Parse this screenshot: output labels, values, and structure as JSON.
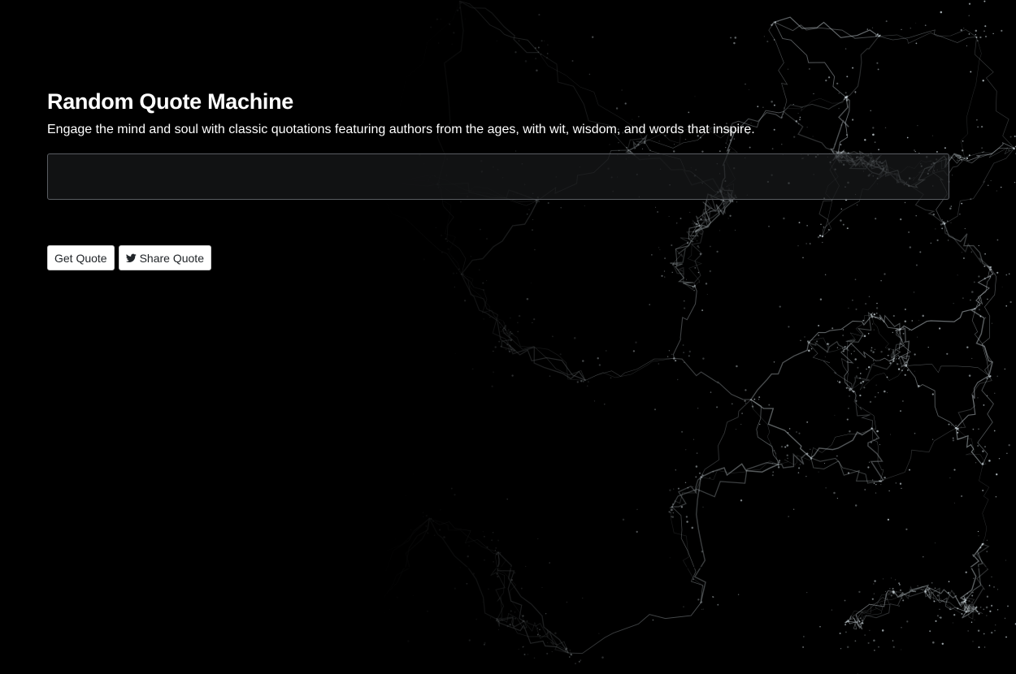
{
  "header": {
    "title": "Random Quote Machine",
    "subtitle": "Engage the mind and soul with classic quotations featuring authors from the ages, with wit, wisdom, and words that inspire."
  },
  "quote": {
    "text": ""
  },
  "actions": {
    "get_quote_label": "Get Quote",
    "share_quote_label": "Share Quote",
    "share_icon": "twitter-bird-icon"
  },
  "background": {
    "image": "cosmic-web-filaments",
    "base_color": "#000000",
    "filament_color": "#c9d3d8"
  }
}
